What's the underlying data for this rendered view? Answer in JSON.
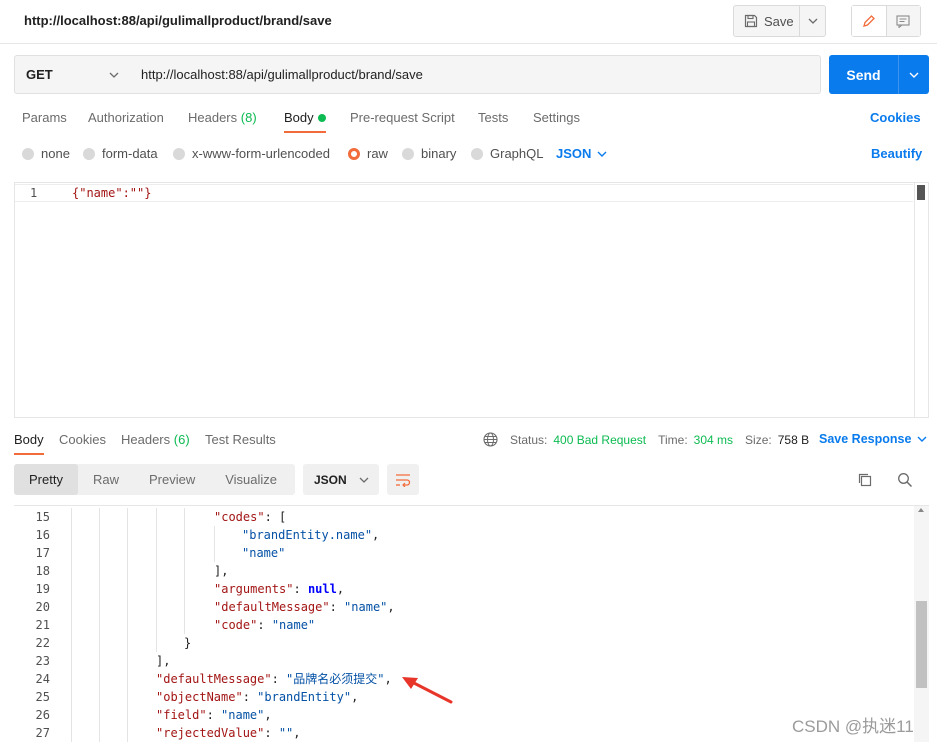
{
  "header": {
    "title": "http://localhost:88/api/gulimallproduct/brand/save",
    "save_label": "Save"
  },
  "request": {
    "method": "GET",
    "url": "http://localhost:88/api/gulimallproduct/brand/save",
    "send_label": "Send",
    "tabs": [
      {
        "label": "Params"
      },
      {
        "label": "Authorization"
      },
      {
        "label": "Headers",
        "count": "(8)"
      },
      {
        "label": "Body"
      },
      {
        "label": "Pre-request Script"
      },
      {
        "label": "Tests"
      },
      {
        "label": "Settings"
      }
    ],
    "cookies_label": "Cookies",
    "body_types": [
      "none",
      "form-data",
      "x-www-form-urlencoded",
      "raw",
      "binary",
      "GraphQL"
    ],
    "selected_body_type": "raw",
    "format": "JSON",
    "beautify_label": "Beautify",
    "editor": {
      "line_number": "1",
      "code": "{\"name\":\"\"}"
    }
  },
  "response": {
    "tabs": [
      {
        "label": "Body"
      },
      {
        "label": "Cookies"
      },
      {
        "label": "Headers",
        "count": "(6)"
      },
      {
        "label": "Test Results"
      }
    ],
    "status_label": "Status:",
    "status_value": "400 Bad Request",
    "time_label": "Time:",
    "time_value": "304 ms",
    "size_label": "Size:",
    "size_value": "758 B",
    "save_response_label": "Save Response",
    "view_tabs": [
      "Pretty",
      "Raw",
      "Preview",
      "Visualize"
    ],
    "format": "JSON",
    "lines": [
      {
        "n": "15",
        "indent": 6,
        "tokens": [
          [
            "key",
            "\"codes\""
          ],
          [
            "punc",
            ": ["
          ]
        ]
      },
      {
        "n": "16",
        "indent": 7,
        "tokens": [
          [
            "str",
            "\"brandEntity.name\""
          ],
          [
            "punc",
            ","
          ]
        ]
      },
      {
        "n": "17",
        "indent": 7,
        "tokens": [
          [
            "str",
            "\"name\""
          ]
        ]
      },
      {
        "n": "18",
        "indent": 6,
        "tokens": [
          [
            "punc",
            "],"
          ]
        ]
      },
      {
        "n": "19",
        "indent": 6,
        "tokens": [
          [
            "key",
            "\"arguments\""
          ],
          [
            "punc",
            ": "
          ],
          [
            "kw",
            "null"
          ],
          [
            "punc",
            ","
          ]
        ]
      },
      {
        "n": "20",
        "indent": 6,
        "tokens": [
          [
            "key",
            "\"defaultMessage\""
          ],
          [
            "punc",
            ": "
          ],
          [
            "str",
            "\"name\""
          ],
          [
            "punc",
            ","
          ]
        ]
      },
      {
        "n": "21",
        "indent": 6,
        "tokens": [
          [
            "key",
            "\"code\""
          ],
          [
            "punc",
            ": "
          ],
          [
            "str",
            "\"name\""
          ]
        ]
      },
      {
        "n": "22",
        "indent": 5,
        "tokens": [
          [
            "punc",
            "}"
          ]
        ]
      },
      {
        "n": "23",
        "indent": 4,
        "tokens": [
          [
            "punc",
            "],"
          ]
        ]
      },
      {
        "n": "24",
        "indent": 4,
        "tokens": [
          [
            "key",
            "\"defaultMessage\""
          ],
          [
            "punc",
            ": "
          ],
          [
            "str",
            "\"品牌名必须提交\""
          ],
          [
            "punc",
            ","
          ]
        ]
      },
      {
        "n": "25",
        "indent": 4,
        "tokens": [
          [
            "key",
            "\"objectName\""
          ],
          [
            "punc",
            ": "
          ],
          [
            "str",
            "\"brandEntity\""
          ],
          [
            "punc",
            ","
          ]
        ]
      },
      {
        "n": "26",
        "indent": 4,
        "tokens": [
          [
            "key",
            "\"field\""
          ],
          [
            "punc",
            ": "
          ],
          [
            "str",
            "\"name\""
          ],
          [
            "punc",
            ","
          ]
        ]
      },
      {
        "n": "27",
        "indent": 4,
        "tokens": [
          [
            "key",
            "\"rejectedValue\""
          ],
          [
            "punc",
            ": "
          ],
          [
            "str",
            "\"\""
          ],
          [
            "punc",
            ","
          ]
        ]
      }
    ]
  },
  "watermark": "CSDN @执迷11",
  "colors": {
    "accent_blue": "#097bed",
    "active_orange": "#f26b3a",
    "success_green": "#0cbb52",
    "annotation_red": "#e8352a"
  },
  "icons": {
    "save": "save-icon",
    "edit": "pencil-icon",
    "docs": "comment-icon",
    "globe": "globe-icon",
    "wrap": "wrap-lines-icon",
    "copy": "copy-icon",
    "search": "search-icon"
  }
}
